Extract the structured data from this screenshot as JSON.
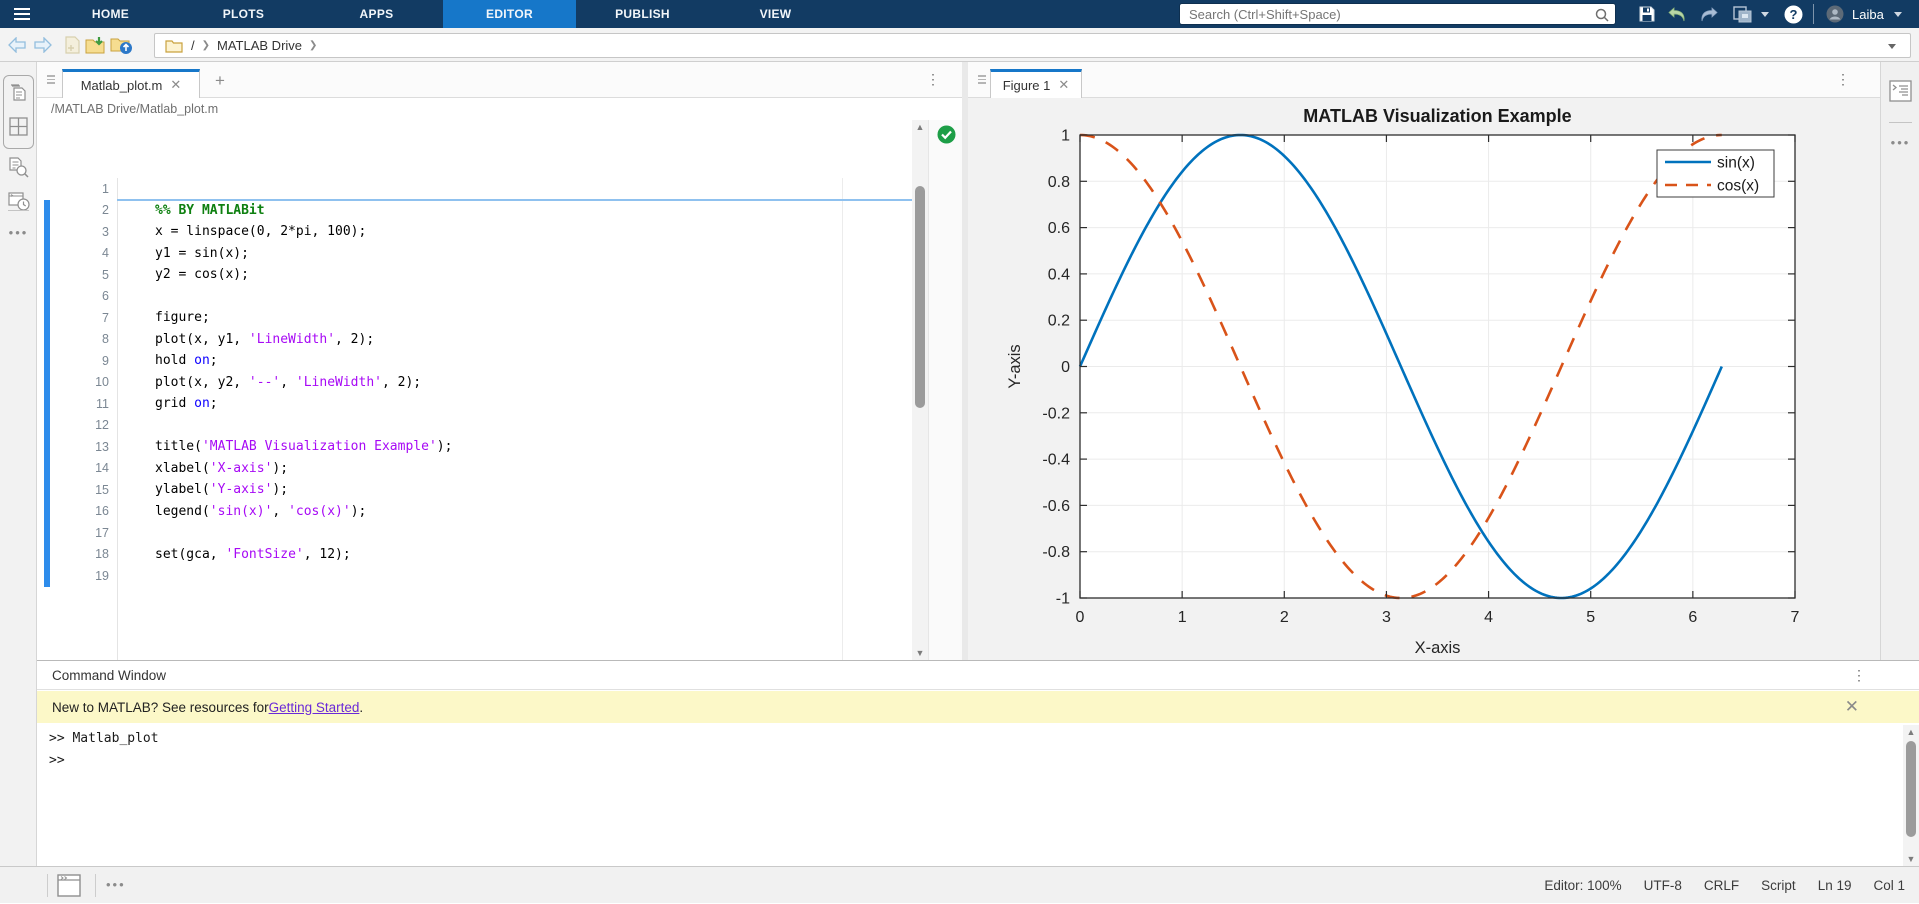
{
  "top_nav": {
    "tabs": [
      "HOME",
      "PLOTS",
      "APPS",
      "EDITOR",
      "PUBLISH",
      "VIEW"
    ],
    "active_tab": "EDITOR",
    "search_placeholder": "Search (Ctrl+Shift+Space)",
    "user_name": "Laiba"
  },
  "toolbar": {
    "breadcrumb": {
      "root": "/",
      "folder": "MATLAB Drive"
    }
  },
  "editor": {
    "tab_label": "Matlab_plot.m",
    "file_path": "/MATLAB Drive/Matlab_plot.m",
    "lines": [
      {
        "code": []
      },
      {
        "code": [
          {
            "t": "%% BY MATLABit",
            "c": "section"
          }
        ]
      },
      {
        "code": [
          {
            "t": "x = linspace(0, 2*pi, 100);",
            "c": "plain"
          }
        ]
      },
      {
        "code": [
          {
            "t": "y1 = sin(x);",
            "c": "plain"
          }
        ]
      },
      {
        "code": [
          {
            "t": "y2 = cos(x);",
            "c": "plain"
          }
        ]
      },
      {
        "code": []
      },
      {
        "code": [
          {
            "t": "figure;",
            "c": "plain"
          }
        ]
      },
      {
        "code": [
          {
            "t": "plot(x, y1, ",
            "c": "plain"
          },
          {
            "t": "'LineWidth'",
            "c": "string"
          },
          {
            "t": ", 2);",
            "c": "plain"
          }
        ]
      },
      {
        "code": [
          {
            "t": "hold ",
            "c": "plain"
          },
          {
            "t": "on",
            "c": "keyword"
          },
          {
            "t": ";",
            "c": "plain"
          }
        ]
      },
      {
        "code": [
          {
            "t": "plot(x, y2, ",
            "c": "plain"
          },
          {
            "t": "'--'",
            "c": "string"
          },
          {
            "t": ", ",
            "c": "plain"
          },
          {
            "t": "'LineWidth'",
            "c": "string"
          },
          {
            "t": ", 2);",
            "c": "plain"
          }
        ]
      },
      {
        "code": [
          {
            "t": "grid ",
            "c": "plain"
          },
          {
            "t": "on",
            "c": "keyword"
          },
          {
            "t": ";",
            "c": "plain"
          }
        ]
      },
      {
        "code": []
      },
      {
        "code": [
          {
            "t": "title(",
            "c": "plain"
          },
          {
            "t": "'MATLAB Visualization Example'",
            "c": "string"
          },
          {
            "t": ");",
            "c": "plain"
          }
        ]
      },
      {
        "code": [
          {
            "t": "xlabel(",
            "c": "plain"
          },
          {
            "t": "'X-axis'",
            "c": "string"
          },
          {
            "t": ");",
            "c": "plain"
          }
        ]
      },
      {
        "code": [
          {
            "t": "ylabel(",
            "c": "plain"
          },
          {
            "t": "'Y-axis'",
            "c": "string"
          },
          {
            "t": ");",
            "c": "plain"
          }
        ]
      },
      {
        "code": [
          {
            "t": "legend(",
            "c": "plain"
          },
          {
            "t": "'sin(x)'",
            "c": "string"
          },
          {
            "t": ", ",
            "c": "plain"
          },
          {
            "t": "'cos(x)'",
            "c": "string"
          },
          {
            "t": ");",
            "c": "plain"
          }
        ]
      },
      {
        "code": []
      },
      {
        "code": [
          {
            "t": "set(gca, ",
            "c": "plain"
          },
          {
            "t": "'FontSize'",
            "c": "string"
          },
          {
            "t": ", 12);",
            "c": "plain"
          }
        ]
      },
      {
        "code": []
      }
    ]
  },
  "figure_panel": {
    "tab_label": "Figure 1"
  },
  "chart_data": {
    "type": "line",
    "title": "MATLAB Visualization Example",
    "xlabel": "X-axis",
    "ylabel": "Y-axis",
    "xlim": [
      0,
      7
    ],
    "ylim": [
      -1,
      1
    ],
    "xticks": [
      0,
      1,
      2,
      3,
      4,
      5,
      6,
      7
    ],
    "yticks": [
      -1,
      -0.8,
      -0.6,
      -0.4,
      -0.2,
      0,
      0.2,
      0.4,
      0.6,
      0.8,
      1
    ],
    "grid": true,
    "legend_position": "northeast",
    "series": [
      {
        "name": "sin(x)",
        "fn": "sin",
        "x_range": [
          0,
          6.2832
        ],
        "color": "#0072BD",
        "style": "solid",
        "linewidth": 2
      },
      {
        "name": "cos(x)",
        "fn": "cos",
        "x_range": [
          0,
          6.2832
        ],
        "color": "#D95319",
        "style": "dashed",
        "linewidth": 2
      }
    ]
  },
  "command_window": {
    "title": "Command Window",
    "banner": {
      "prefix": "New to MATLAB? See resources for ",
      "link_text": "Getting Started",
      "suffix": "."
    },
    "console_lines": [
      ">> Matlab_plot",
      ">>"
    ]
  },
  "status_bar": {
    "items": [
      "Editor: 100%",
      "UTF-8",
      "CRLF",
      "Script",
      "Ln 19",
      "Col 1"
    ]
  }
}
